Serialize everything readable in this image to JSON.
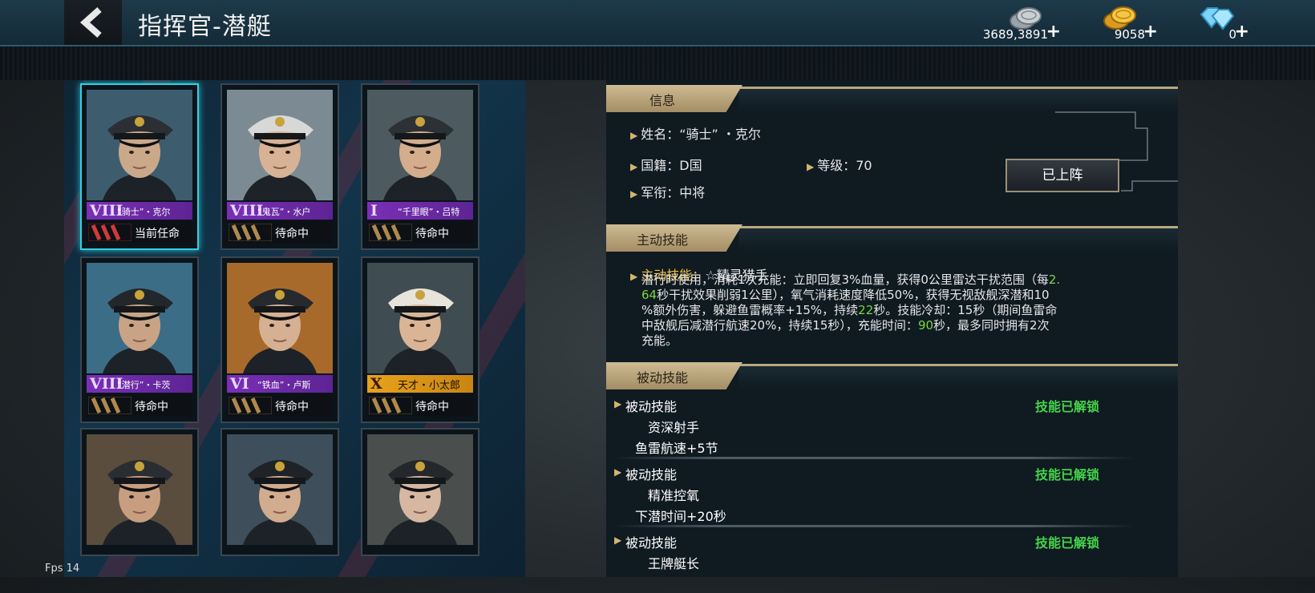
{
  "header": {
    "title": "指挥官-潜艇",
    "currencies": [
      {
        "name": "silver",
        "amount": "3689,3891",
        "icon": "silver-coins-icon"
      },
      {
        "name": "gold",
        "amount": "9058",
        "icon": "gold-coins-icon"
      },
      {
        "name": "diamond",
        "amount": "0",
        "icon": "diamond-icon"
      }
    ],
    "plus": "+"
  },
  "roster": [
    {
      "rank": "VIII",
      "name": "“骑士”・克尔",
      "status": "当前任命",
      "selected": true,
      "bar": "purple",
      "chevron_color": "#d23a3a"
    },
    {
      "rank": "VIII",
      "name": "“鬼瓦”・水户",
      "status": "待命中",
      "selected": false,
      "bar": "purple",
      "chevron_color": "#b08a4c"
    },
    {
      "rank": "I",
      "name": "“千里眼”・吕特",
      "status": "待命中",
      "selected": false,
      "bar": "purple",
      "chevron_color": "#b08a4c"
    },
    {
      "rank": "VIII",
      "name": "“潜行”・卡茨",
      "status": "待命中",
      "selected": false,
      "bar": "purple",
      "chevron_color": "#b08a4c"
    },
    {
      "rank": "VI",
      "name": "“铁血”・卢斯",
      "status": "待命中",
      "selected": false,
      "bar": "purple",
      "chevron_color": "#b08a4c"
    },
    {
      "rank": "X",
      "name": "天才・小太郎",
      "status": "待命中",
      "selected": false,
      "bar": "gold",
      "chevron_color": "#b08a4c"
    },
    {
      "rank": "",
      "name": "",
      "status": "",
      "selected": false,
      "bar": "none",
      "chevron_color": "#b08a4c"
    },
    {
      "rank": "",
      "name": "",
      "status": "",
      "selected": false,
      "bar": "none",
      "chevron_color": "#b08a4c"
    },
    {
      "rank": "",
      "name": "",
      "status": "",
      "selected": false,
      "bar": "none",
      "chevron_color": "#b08a4c"
    }
  ],
  "info": {
    "section_label": "信息",
    "name_label": "姓名：",
    "name_value": "“骑士” ・克尔",
    "nation_label": "国籍：",
    "nation_value": "D国",
    "level_label": "等级：",
    "level_value": "70",
    "rank_label": "军衔：",
    "rank_value": "中将",
    "deploy_button": "已上阵"
  },
  "active_skill": {
    "section_label": "主动技能",
    "label": "主动技能：",
    "name": "☆精灵猎手",
    "desc_lines": [
      [
        "潜行时使用，消耗1次充能：立即回复3%血量，获得0公里雷达干扰范围（每",
        "2."
      ],
      [
        "64",
        "秒干扰效果削弱1公里），氧气消耗速度降低50%，获得无视敌舰深潜和10"
      ],
      [
        "%额外伤害，躲避鱼雷概率+15%，持续",
        "22",
        "秒。技能冷却：15秒（期间鱼雷命"
      ],
      [
        "中敌舰后减潜行航速20%，持续15秒），充能时间：",
        "90",
        "秒，最多同时拥有2次"
      ],
      [
        "充能。"
      ]
    ]
  },
  "passive_skills": {
    "section_label": "被动技能",
    "items": [
      {
        "title": "被动技能",
        "unlock": "技能已解锁",
        "name": "资深射手",
        "effect": "鱼雷航速+5节"
      },
      {
        "title": "被动技能",
        "unlock": "技能已解锁",
        "name": "精准控氧",
        "effect": "下潜时间+20秒"
      },
      {
        "title": "被动技能",
        "unlock": "技能已解锁",
        "name": "王牌艇长",
        "effect": ""
      }
    ]
  },
  "fps": "Fps 14",
  "colors": {
    "accent_gold": "#cdbb93",
    "unlock_green": "#46d24b",
    "highlight_green": "#7dd640",
    "selected_cyan": "#33d0e0",
    "name_purple": "#7a2fb6"
  }
}
